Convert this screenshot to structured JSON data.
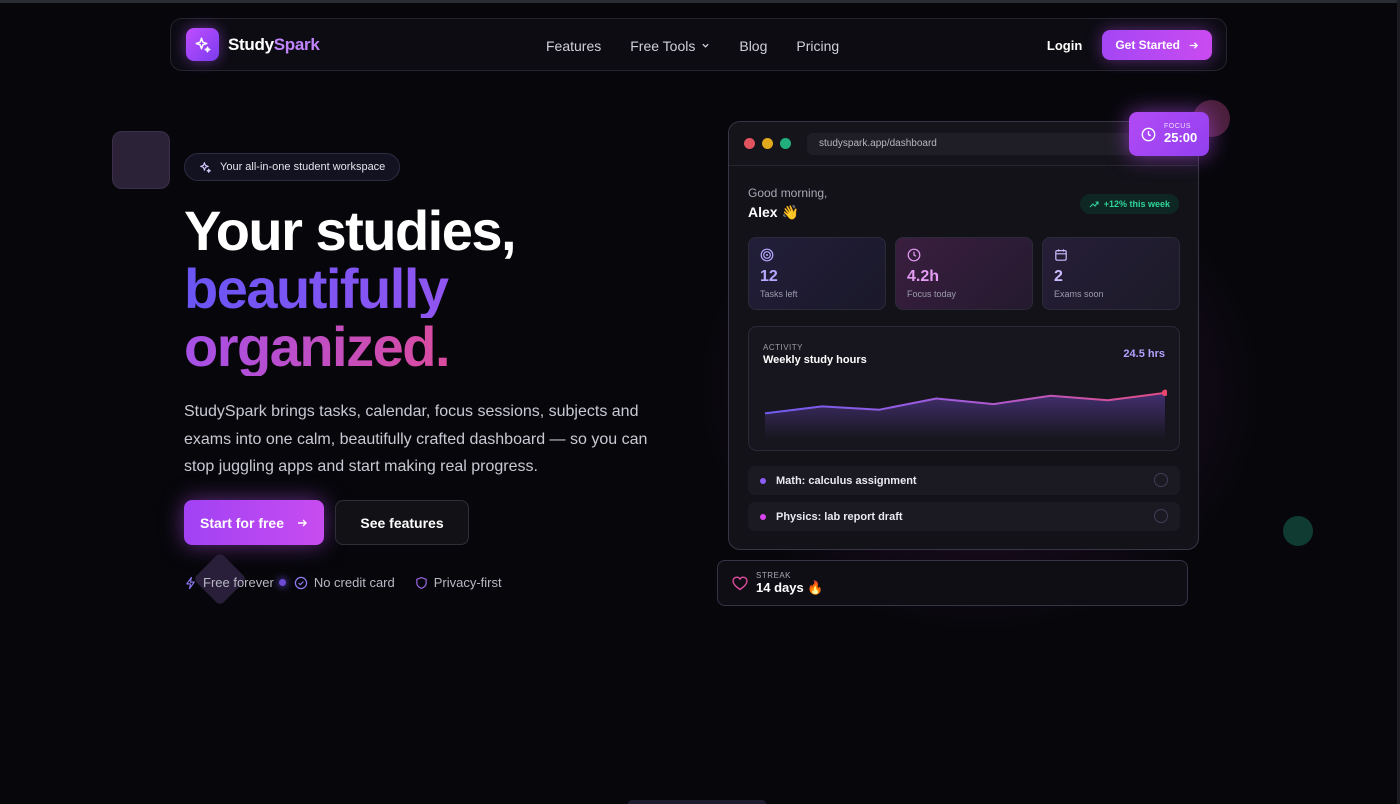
{
  "brand": {
    "name_part1": "Study",
    "name_part2": "Spark"
  },
  "nav": {
    "items": [
      "Features",
      "Free Tools",
      "Blog",
      "Pricing"
    ],
    "login": "Login",
    "cta": "Get Started"
  },
  "hero": {
    "pill": "Your all-in-one student workspace",
    "title_line1": "Your studies,",
    "title_line2": "beautifully",
    "title_line3": "organized.",
    "lead": "StudySpark brings tasks, calendar, focus sessions, subjects and exams into one calm, beautifully crafted dashboard — so you can stop juggling apps and start making real progress.",
    "cta_primary": "Start for free",
    "cta_secondary": "See features",
    "badges": [
      "Free forever",
      "No credit card",
      "Privacy-first"
    ]
  },
  "dashboard": {
    "url": "studyspark.app/dashboard",
    "greeting": "Good morning,",
    "name": "Alex 👋",
    "trend": "+12% this week",
    "stats": [
      {
        "value": "12",
        "label": "Tasks left",
        "icon": "target-icon"
      },
      {
        "value": "4.2h",
        "label": "Focus today",
        "icon": "clock-icon"
      },
      {
        "value": "2",
        "label": "Exams soon",
        "icon": "calendar-icon"
      }
    ],
    "activity": {
      "kicker": "ACTIVITY",
      "title": "Weekly study hours",
      "total": "24.5 hrs",
      "points": [
        1.2,
        2.7,
        2.0,
        4.4,
        3.2,
        5.0,
        4.0,
        5.6
      ]
    },
    "tasks": [
      {
        "text": "Math: calculus assignment",
        "color": "#8b5cf6"
      },
      {
        "text": "Physics: lab report draft",
        "color": "#d946ef"
      }
    ]
  },
  "focus": {
    "kicker": "FOCUS",
    "time": "25:00"
  },
  "streak": {
    "kicker": "STREAK",
    "value": "14 days 🔥"
  },
  "colors": {
    "accent": "#a546f5",
    "pink": "#e84a8c",
    "green": "#2fd49a"
  }
}
